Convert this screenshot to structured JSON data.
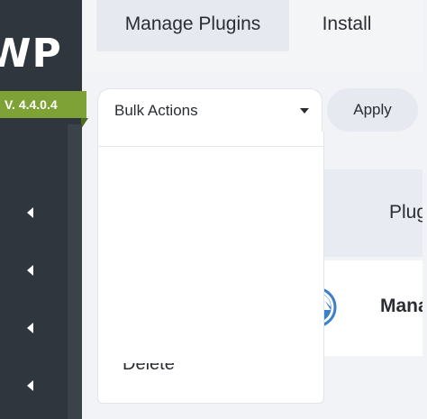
{
  "app": {
    "logo_text": "WP",
    "version": "V. 4.4.0.4"
  },
  "tabs": [
    {
      "label": "Manage Plugins",
      "active": true
    },
    {
      "label": "Install",
      "active": false
    }
  ],
  "toolbar": {
    "bulk_actions_label": "Bulk Actions",
    "apply_label": "Apply",
    "dropdown_options": [
      "Delete"
    ]
  },
  "table": {
    "column_header": "Plugi",
    "rows": [
      {
        "name": "Mana",
        "icon": "mountain-logo-icon"
      }
    ]
  },
  "sidebar": {
    "arrow_count": 4
  },
  "colors": {
    "sidebar_bg": "#2f363d",
    "version_badge": "#7ea236",
    "plugin_icon": "#3c80c8"
  }
}
